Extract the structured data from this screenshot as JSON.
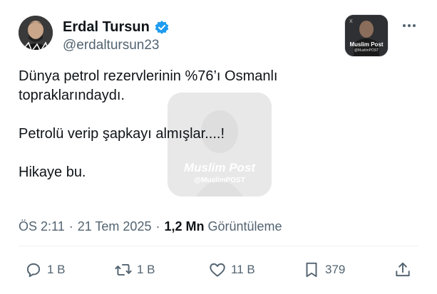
{
  "author": {
    "name": "Erdal Tursun",
    "handle": "@erdaltursun23"
  },
  "badge": {
    "title": "Muslim Post",
    "subtitle": "@MuslimPOST"
  },
  "tweet": {
    "line1": "Dünya petrol rezervlerinin %76’ı Osmanlı",
    "line2": "topraklarındaydı.",
    "line3": "Petrolü verip şapkayı almışlar....!",
    "line4": "Hikaye bu."
  },
  "watermark": {
    "title": "Muslim Post",
    "subtitle": "@MuslimPOST"
  },
  "meta": {
    "time": "ÖS 2:11",
    "dot1": "·",
    "date": "21 Tem 2025",
    "dot2": "·",
    "views_count": "1,2 Mn",
    "views_label": "Görüntüleme"
  },
  "actions": {
    "replies": "1 B",
    "reposts": "1 B",
    "likes": "11 B",
    "bookmarks": "379"
  },
  "colors": {
    "text": "#0f1419",
    "secondary": "#536471",
    "verified": "#1d9bf0"
  }
}
